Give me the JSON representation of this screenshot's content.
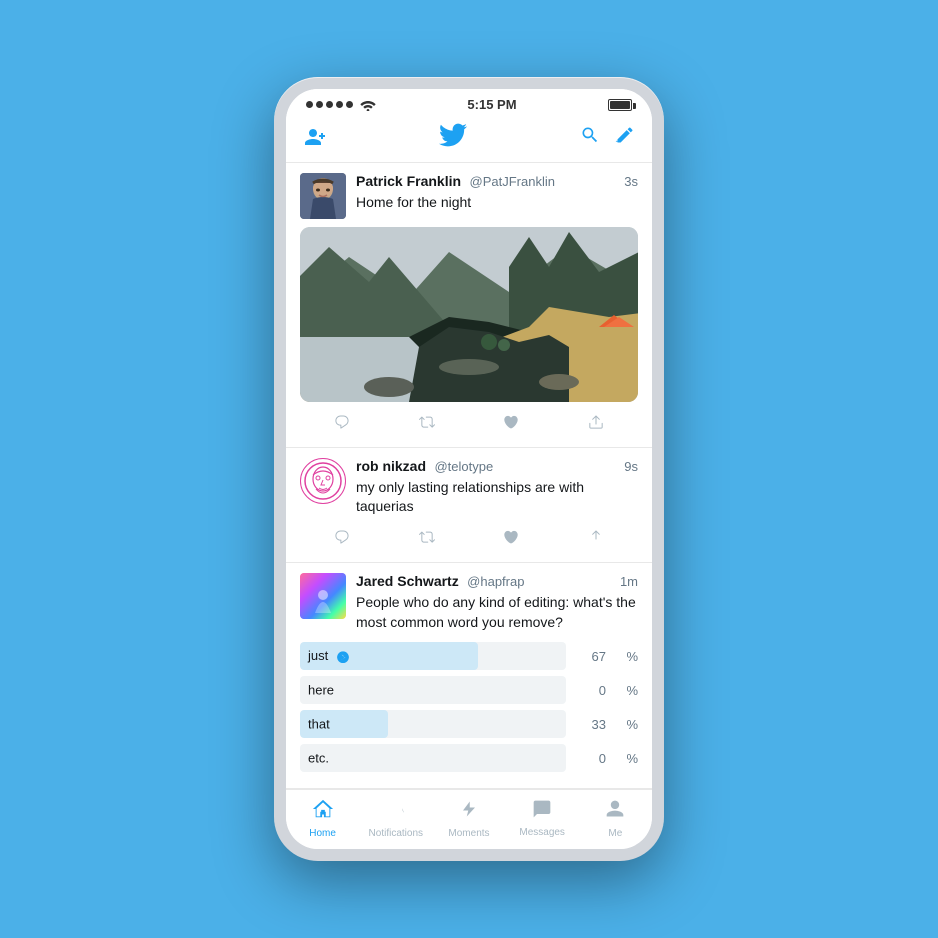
{
  "phone": {
    "status_bar": {
      "time": "5:15 PM",
      "signal_dots": 5,
      "wifi": "wifi",
      "battery": "full"
    },
    "top_nav": {
      "add_user_icon": "+👤",
      "twitter_logo": "🐦",
      "search_icon": "🔍",
      "compose_icon": "✏️"
    },
    "tweets": [
      {
        "id": "tweet-1",
        "user_name": "Patrick Franklin",
        "handle": "@PatJFranklin",
        "time": "3s",
        "text": "Home for the night",
        "has_image": true
      },
      {
        "id": "tweet-2",
        "user_name": "rob nikzad",
        "handle": "@telotype",
        "time": "9s",
        "text": "my only lasting relationships are with taquerias",
        "has_image": false
      },
      {
        "id": "tweet-3",
        "user_name": "Jared Schwartz",
        "handle": "@hapfrap",
        "time": "1m",
        "text": "People who do any kind of editing: what's the most common word you remove?",
        "has_poll": true,
        "poll": {
          "options": [
            {
              "label": "just",
              "percent": 67,
              "width": 67,
              "voted": true
            },
            {
              "label": "here",
              "percent": 0,
              "width": 0,
              "voted": false
            },
            {
              "label": "that",
              "percent": 33,
              "width": 33,
              "voted": false
            },
            {
              "label": "etc.",
              "percent": 0,
              "width": 0,
              "voted": false
            }
          ]
        }
      }
    ],
    "tab_bar": {
      "tabs": [
        {
          "id": "home",
          "label": "Home",
          "icon": "home",
          "active": true
        },
        {
          "id": "notifications",
          "label": "Notifications",
          "icon": "bell",
          "active": false
        },
        {
          "id": "moments",
          "label": "Moments",
          "icon": "bolt",
          "active": false
        },
        {
          "id": "messages",
          "label": "Messages",
          "icon": "envelope",
          "active": false
        },
        {
          "id": "me",
          "label": "Me",
          "icon": "person",
          "active": false
        }
      ]
    }
  }
}
